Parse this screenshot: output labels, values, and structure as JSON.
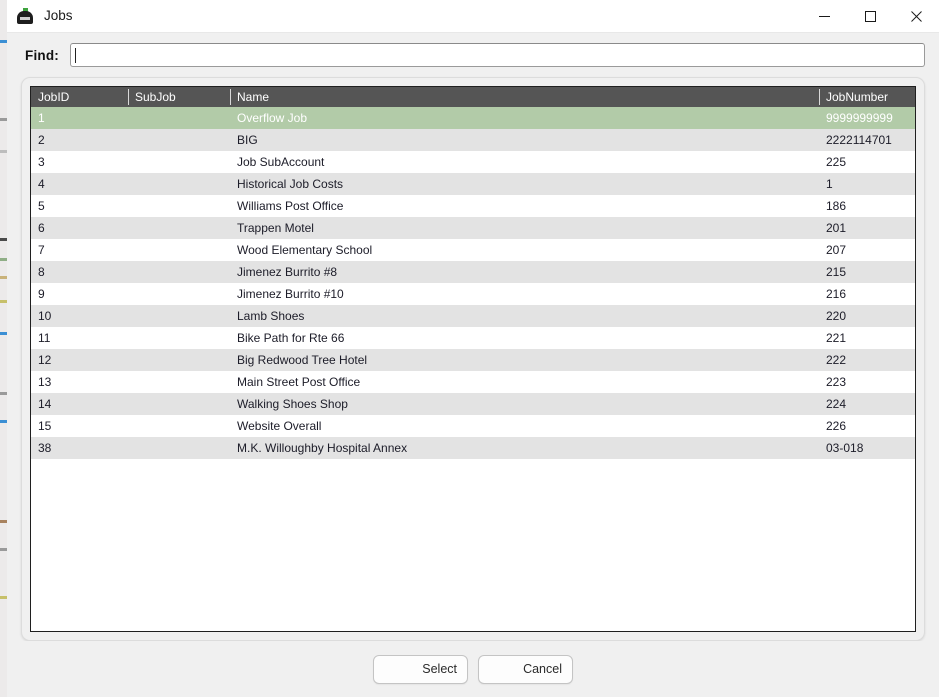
{
  "window": {
    "title": "Jobs",
    "icon": "jobs-app-icon",
    "controls": {
      "minimize": "minimize-icon",
      "maximize": "maximize-icon",
      "close": "close-icon"
    }
  },
  "find": {
    "label": "Find:",
    "value": "",
    "placeholder": ""
  },
  "grid": {
    "columns": [
      {
        "key": "jobid",
        "label": "JobID"
      },
      {
        "key": "subjob",
        "label": "SubJob"
      },
      {
        "key": "name",
        "label": "Name"
      },
      {
        "key": "jobnum",
        "label": "JobNumber"
      }
    ],
    "rows": [
      {
        "jobid": "1",
        "subjob": "",
        "name": "Overflow Job",
        "jobnum": "9999999999",
        "selected": true
      },
      {
        "jobid": "2",
        "subjob": "",
        "name": "BIG",
        "jobnum": "2222114701"
      },
      {
        "jobid": "3",
        "subjob": "",
        "name": "Job SubAccount",
        "jobnum": "225"
      },
      {
        "jobid": "4",
        "subjob": "",
        "name": "Historical Job Costs",
        "jobnum": "1"
      },
      {
        "jobid": "5",
        "subjob": "",
        "name": "Williams Post Office",
        "jobnum": "186"
      },
      {
        "jobid": "6",
        "subjob": "",
        "name": "Trappen Motel",
        "jobnum": "201"
      },
      {
        "jobid": "7",
        "subjob": "",
        "name": "Wood Elementary School",
        "jobnum": "207"
      },
      {
        "jobid": "8",
        "subjob": "",
        "name": "Jimenez Burrito #8",
        "jobnum": "215"
      },
      {
        "jobid": "9",
        "subjob": "",
        "name": "Jimenez Burrito #10",
        "jobnum": "216"
      },
      {
        "jobid": "10",
        "subjob": "",
        "name": "Lamb Shoes",
        "jobnum": "220"
      },
      {
        "jobid": "11",
        "subjob": "",
        "name": "Bike Path for Rte 66",
        "jobnum": "221"
      },
      {
        "jobid": "12",
        "subjob": "",
        "name": "Big Redwood Tree Hotel",
        "jobnum": "222"
      },
      {
        "jobid": "13",
        "subjob": "",
        "name": "Main Street Post Office",
        "jobnum": "223"
      },
      {
        "jobid": "14",
        "subjob": "",
        "name": "Walking Shoes Shop",
        "jobnum": "224"
      },
      {
        "jobid": "15",
        "subjob": "",
        "name": "Website Overall",
        "jobnum": "226"
      },
      {
        "jobid": "38",
        "subjob": "",
        "name": "M.K. Willoughby Hospital Annex",
        "jobnum": "03-018"
      }
    ]
  },
  "footer": {
    "select_label": "Select",
    "cancel_label": "Cancel"
  },
  "colors": {
    "header_bg": "#555555",
    "selected_row": "#b2cba8",
    "alt_row": "#e3e3e3",
    "window_bg": "#f0f0f0"
  }
}
